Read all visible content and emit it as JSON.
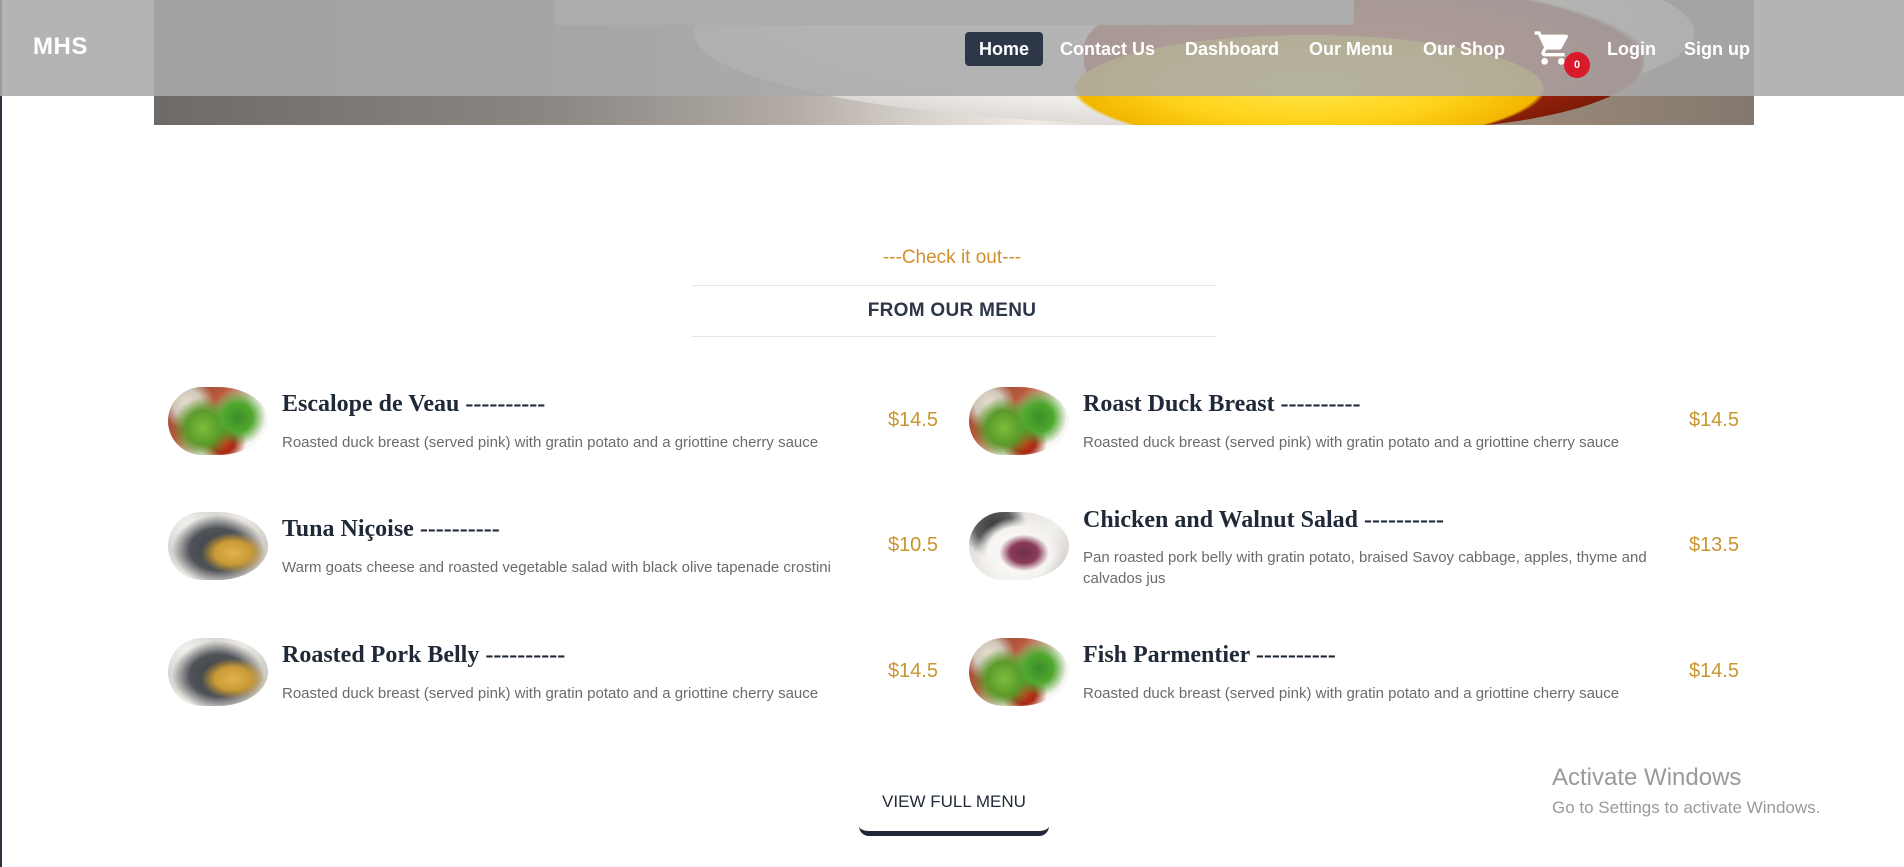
{
  "navbar": {
    "brand": "MHS",
    "items": [
      {
        "label": "Home",
        "active": true
      },
      {
        "label": "Contact Us"
      },
      {
        "label": "Dashboard"
      },
      {
        "label": "Our Menu"
      },
      {
        "label": "Our Shop"
      },
      {
        "label": "Login"
      },
      {
        "label": "Sign up"
      }
    ],
    "cart_count": "0"
  },
  "section": {
    "subtitle": "---Check it out---",
    "title": "FROM OUR MENU"
  },
  "menu": [
    {
      "name": "Escalope de Veau ----------",
      "desc": "Roasted duck breast (served pink) with gratin potato and a griottine cherry sauce",
      "price": "$14.5",
      "image": "salad-plate"
    },
    {
      "name": "Roast Duck Breast ----------",
      "desc": "Roasted duck breast (served pink) with gratin potato and a griottine cherry sauce",
      "price": "$14.5",
      "image": "salad-plate"
    },
    {
      "name": "Tuna Niçoise ----------",
      "desc": "Warm goats cheese and roasted vegetable salad with black olive tapenade crostini",
      "price": "$10.5",
      "image": "tuna-plate"
    },
    {
      "name": "Chicken and Walnut Salad ----------",
      "desc": "Pan roasted pork belly with gratin potato, braised Savoy cabbage, apples, thyme and calvados jus",
      "price": "$13.5",
      "image": "chicken-plate"
    },
    {
      "name": "Roasted Pork Belly ----------",
      "desc": "Roasted duck breast (served pink) with gratin potato and a griottine cherry sauce",
      "price": "$14.5",
      "image": "tuna-plate"
    },
    {
      "name": "Fish Parmentier ----------",
      "desc": "Roasted duck breast (served pink) with gratin potato and a griottine cherry sauce",
      "price": "$14.5",
      "image": "salad-plate"
    }
  ],
  "view_full_menu": "VIEW FULL MENU",
  "watermark": {
    "line1": "Activate Windows",
    "line2": "Go to Settings to activate Windows."
  },
  "colors": {
    "accent": "#d18f2e",
    "price": "#c9952f",
    "nav_active_bg": "#2d3748",
    "cart_badge": "#d91a2a"
  }
}
